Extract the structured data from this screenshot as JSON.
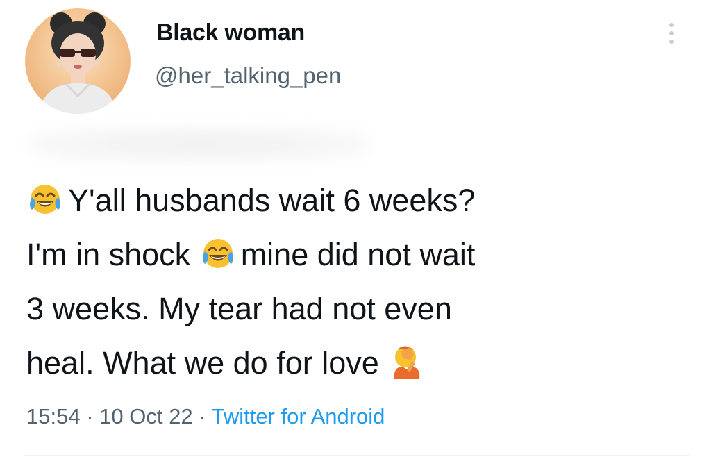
{
  "tweet": {
    "display_name": "Black woman",
    "handle": "@her_talking_pen",
    "text_lines": [
      {
        "before": "",
        "emoji_before": "face-with-tears-of-joy",
        "after": "Y'all husbands wait 6 weeks?"
      },
      {
        "before": "I'm in shock",
        "emoji_before": "face-with-tears-of-joy",
        "after": "mine did not wait"
      },
      {
        "before": "3 weeks. My tear had not even",
        "emoji_before": "",
        "after": ""
      },
      {
        "before": "heal. What we do for love",
        "emoji_before": "person-facepalming",
        "after": ""
      }
    ],
    "line1": "Y'all husbands wait 6 weeks?",
    "line2_a": "I'm in shock",
    "line2_b": "mine did not wait",
    "line3": "3 weeks. My tear had not even",
    "line4": "heal. What we do for love",
    "time": "15:54",
    "date": "10 Oct 22",
    "separator": "·",
    "source": "Twitter for Android"
  },
  "icons": {
    "more": "more-options-icon",
    "avatar": "avatar",
    "emoji_laugh": "face-with-tears-of-joy-icon",
    "emoji_facepalm": "person-facepalming-icon"
  },
  "colors": {
    "text": "#0f1419",
    "secondary": "#536471",
    "link": "#1d9bf0",
    "background": "#ffffff"
  }
}
